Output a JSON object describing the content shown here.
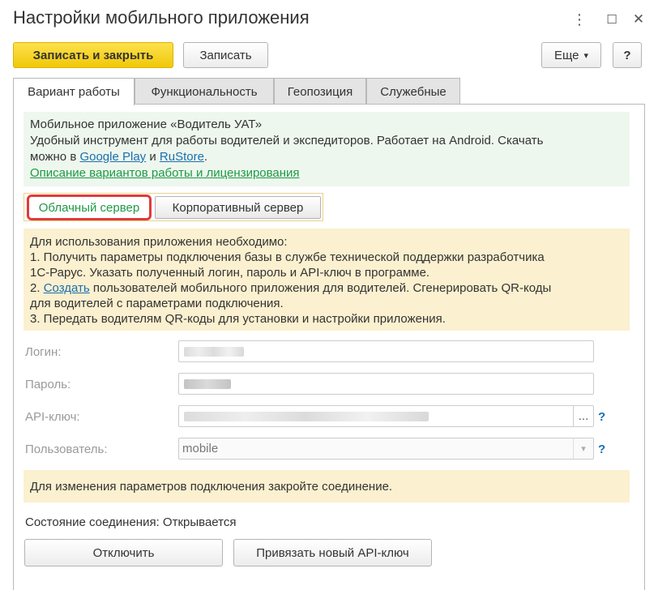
{
  "window": {
    "title": "Настройки мобильного приложения",
    "menu_icon": "⋮",
    "maximize_icon": "☐",
    "close_icon": "✕"
  },
  "toolbar": {
    "save_close": "Записать и закрыть",
    "save": "Записать",
    "more": "Еще",
    "more_arrow": "▾",
    "help": "?"
  },
  "tabs": [
    {
      "label": "Вариант работы",
      "active": true
    },
    {
      "label": "Функциональность",
      "active": false
    },
    {
      "label": "Геопозиция",
      "active": false
    },
    {
      "label": "Служебные",
      "active": false
    }
  ],
  "info": {
    "line1": "Мобильное приложение «Водитель УАТ»",
    "line2": "Удобный инструмент для работы водителей и экспедиторов. Работает на Android. Скачать",
    "line3_prefix": "можно в ",
    "google_play": "Google Play",
    "and": " и ",
    "rustore": "RuStore",
    "line3_suffix": ".",
    "desc_link": "Описание вариантов работы и лицензирования"
  },
  "server_switch": {
    "cloud": "Облачный сервер",
    "corporate": "Корпоративный сервер",
    "selected": "cloud"
  },
  "instructions": {
    "l1": "Для использования приложения необходимо:",
    "l2": "1. Получить параметры подключения базы в службе технической поддержки разработчика",
    "l3": "1С-Рарус. Указать полученный логин, пароль и API-ключ в программе.",
    "l4_prefix": "2. ",
    "l4_link": "Создать",
    "l4_suffix": " пользователей мобильного приложения для водителей. Сгенерировать QR-коды",
    "l5": "для водителей с параметрами подключения.",
    "l6": "3. Передать водителям QR-коды для установки и настройки приложения."
  },
  "form": {
    "login_label": "Логин:",
    "password_label": "Пароль:",
    "api_label": "API-ключ:",
    "api_button": "...",
    "user_label": "Пользователь:",
    "user_value": "mobile",
    "dropdown_arrow": "▾",
    "help_mark": "?"
  },
  "note": "Для изменения параметров подключения закройте соединение.",
  "status": {
    "label": "Состояние соединения:",
    "value": "Открывается"
  },
  "actions": {
    "disconnect": "Отключить",
    "bind_key": "Привязать новый API-ключ"
  }
}
